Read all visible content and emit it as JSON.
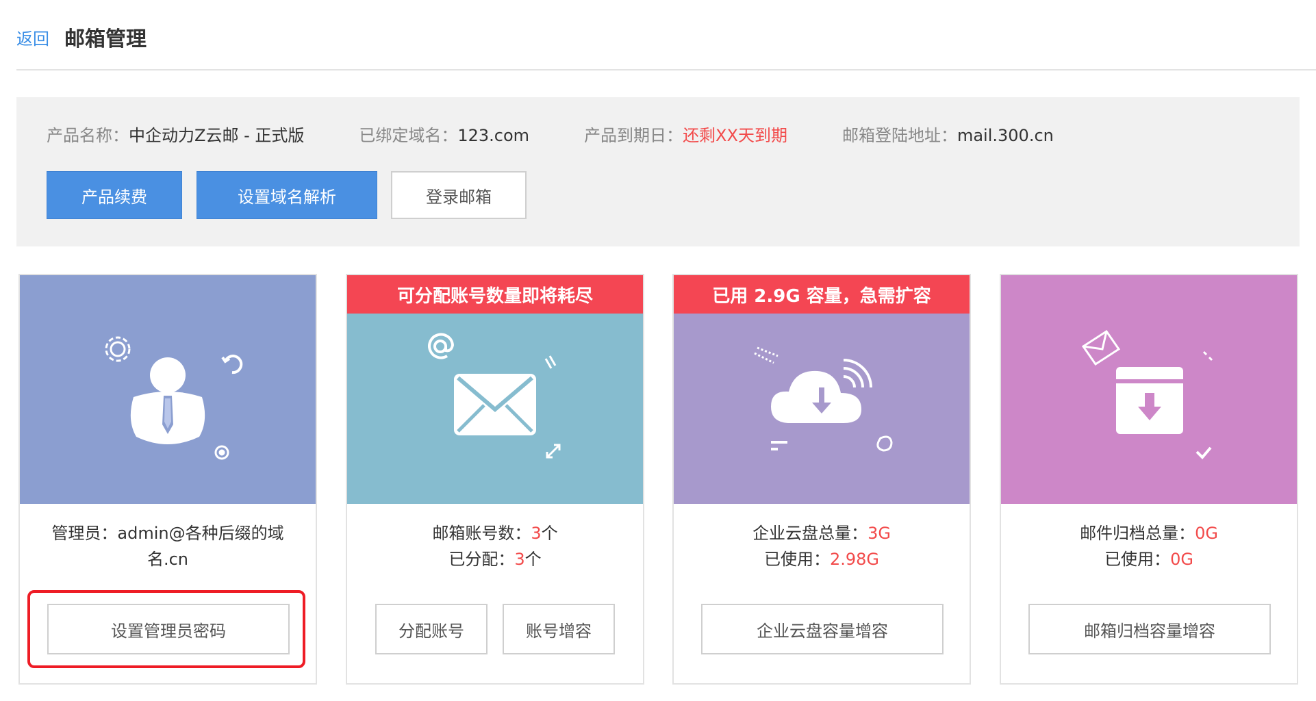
{
  "header": {
    "back_label": "返回",
    "title": "邮箱管理"
  },
  "info": {
    "product_name_label": "产品名称：",
    "product_name_value": "中企动力Z云邮 - 正式版",
    "domain_label": "已绑定域名：",
    "domain_value": "123.com",
    "expiry_label": "产品到期日：",
    "expiry_value": "还剩XX天到期",
    "login_label": "邮箱登陆地址：",
    "login_value": "mail.300.cn"
  },
  "actions": {
    "renew": "产品续费",
    "dns": "设置域名解析",
    "login": "登录邮箱"
  },
  "cards": [
    {
      "line1": "管理员：admin@各种后缀的域",
      "line2": "名.cn",
      "button": "设置管理员密码",
      "color": "#8b9ed0"
    },
    {
      "banner": "可分配账号数量即将耗尽",
      "l1_label": "邮箱账号数：",
      "l1_value": "3",
      "l1_unit": "个",
      "l2_label": "已分配：",
      "l2_value": "3",
      "l2_unit": "个",
      "button1": "分配账号",
      "button2": "账号增容",
      "color": "#86bccf"
    },
    {
      "banner": "已用 2.9G 容量，急需扩容",
      "l1_label": "企业云盘总量：",
      "l1_value": "3G",
      "l2_label": "已使用：",
      "l2_value": "2.98G",
      "button": "企业云盘容量增容",
      "color": "#a799cc"
    },
    {
      "l1_label": "邮件归档总量：",
      "l1_value": "0G",
      "l2_label": "已使用：",
      "l2_value": "0G",
      "button": "邮箱归档容量增容",
      "color": "#cd87c8"
    }
  ],
  "colors": {
    "accent": "#4a90e2",
    "alert": "#f44653",
    "warning_text": "#f24a4a",
    "highlight": "#ee1c25"
  },
  "icons": [
    "admin-user-icon",
    "gear-icon",
    "sync-icon",
    "target-icon",
    "envelope-icon",
    "at-sign-icon",
    "expand-arrows-icon",
    "cloud-download-icon",
    "wifi-signal-icon",
    "archive-box-icon",
    "mail-stamp-icon",
    "check-icon"
  ]
}
